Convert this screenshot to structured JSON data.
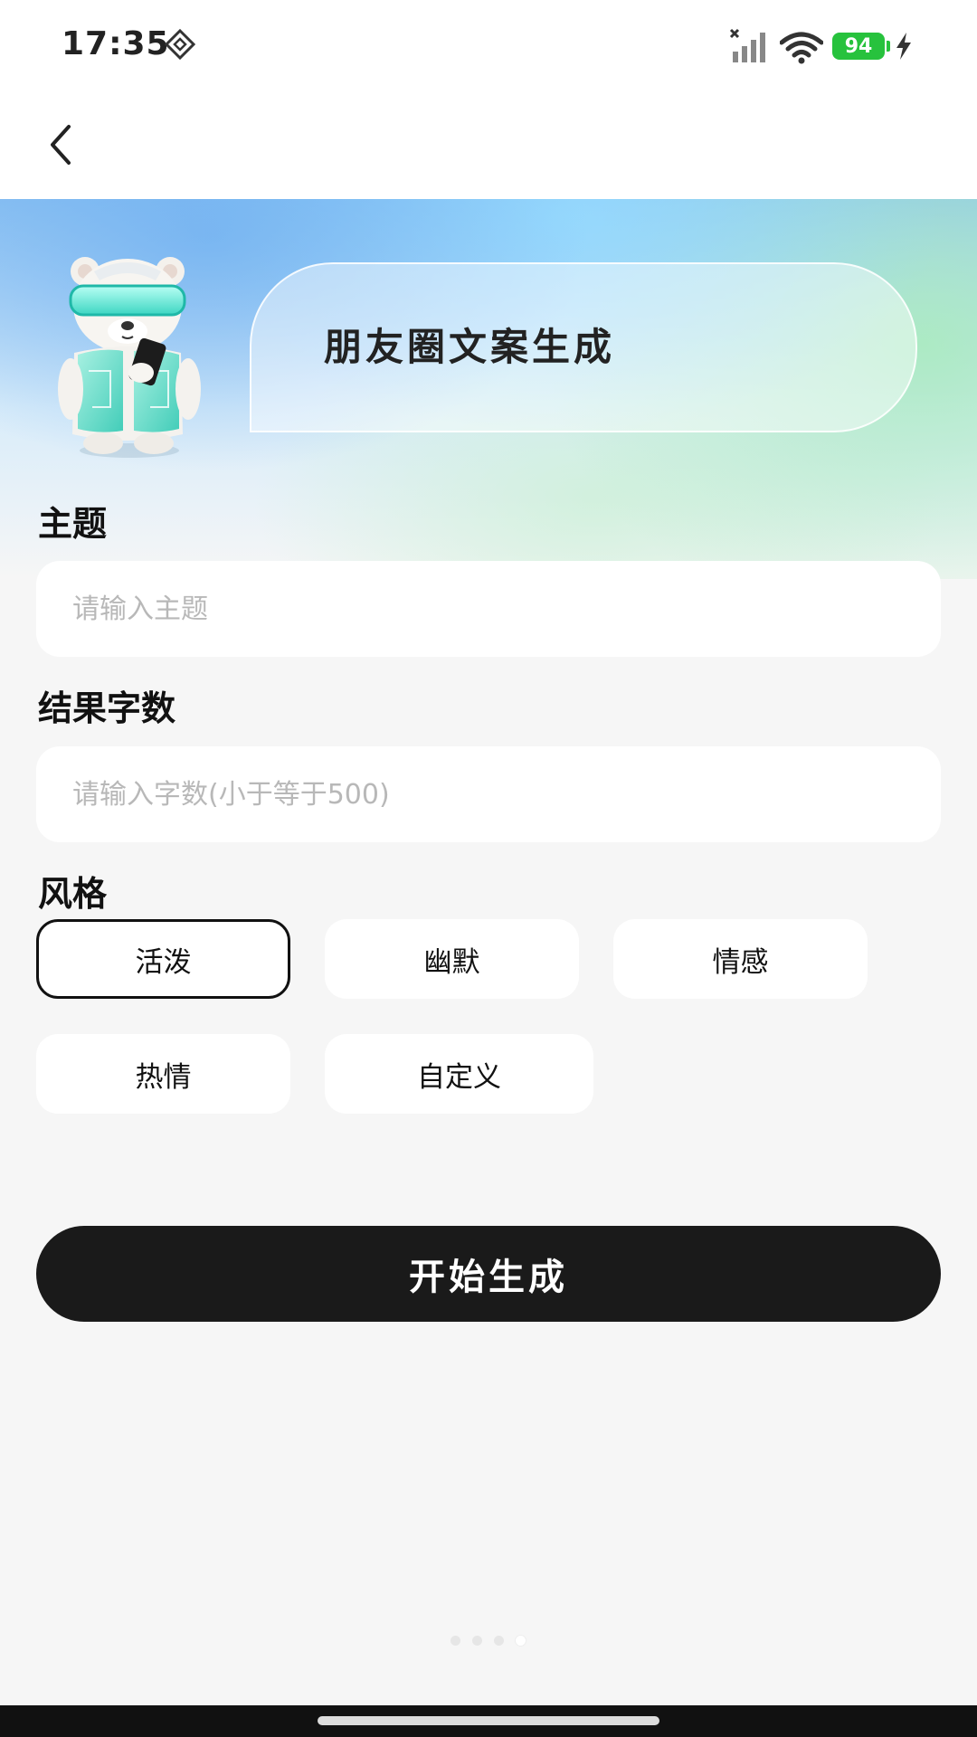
{
  "status_bar": {
    "time": "17:35",
    "battery_level": "94",
    "icons": [
      "nfc-diamond-icon",
      "signal-icon",
      "wifi-icon",
      "battery-icon",
      "charging-bolt-icon"
    ]
  },
  "nav": {
    "back_icon": "chevron-left-icon"
  },
  "hero": {
    "title": "朋友圈文案生成"
  },
  "form": {
    "topic": {
      "label": "主题",
      "placeholder": "请输入主题",
      "value": ""
    },
    "word_count": {
      "label": "结果字数",
      "placeholder": "请输入字数(小于等于500)",
      "value": ""
    },
    "style": {
      "label": "风格",
      "options": [
        "活泼",
        "幽默",
        "情感",
        "热情",
        "自定义"
      ],
      "selected": "活泼"
    }
  },
  "start_button": {
    "label": "开始生成"
  },
  "pager": {
    "count": 4,
    "active_index": 3
  },
  "colors": {
    "accent": "#1a1a1a",
    "battery": "#27c23d",
    "background": "#f6f6f6"
  }
}
